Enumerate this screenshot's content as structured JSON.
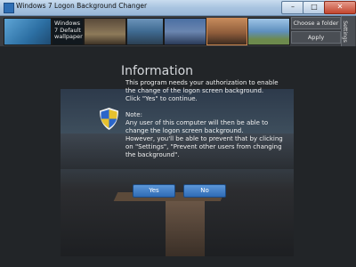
{
  "window": {
    "title": "Windows 7 Logon Background Changer",
    "min_label": "–",
    "max_label": "□",
    "close_label": "✕"
  },
  "strip": {
    "thumb_label": "Windows 7 Default wallpaper",
    "choose_folder": "Choose a folder",
    "apply": "Apply",
    "settings_tab": "Settings"
  },
  "info": {
    "title": "Information",
    "para1": "This program needs your authorization to enable the change of the logon screen background.",
    "para2": "Click \"Yes\" to continue.",
    "note_label": "Note:",
    "para3": "Any user of this computer will then be able to change the logon screen background.",
    "para4": "However, you'll be able to prevent that by clicking on \"Settings\", \"Prevent other users from changing the background\".",
    "yes": "Yes",
    "no": "No"
  },
  "icons": {
    "app": "app-icon",
    "uac": "uac-shield-icon"
  },
  "colors": {
    "accent": "#2f6bb5",
    "background": "#24272b",
    "text": "#f0f0f0"
  }
}
